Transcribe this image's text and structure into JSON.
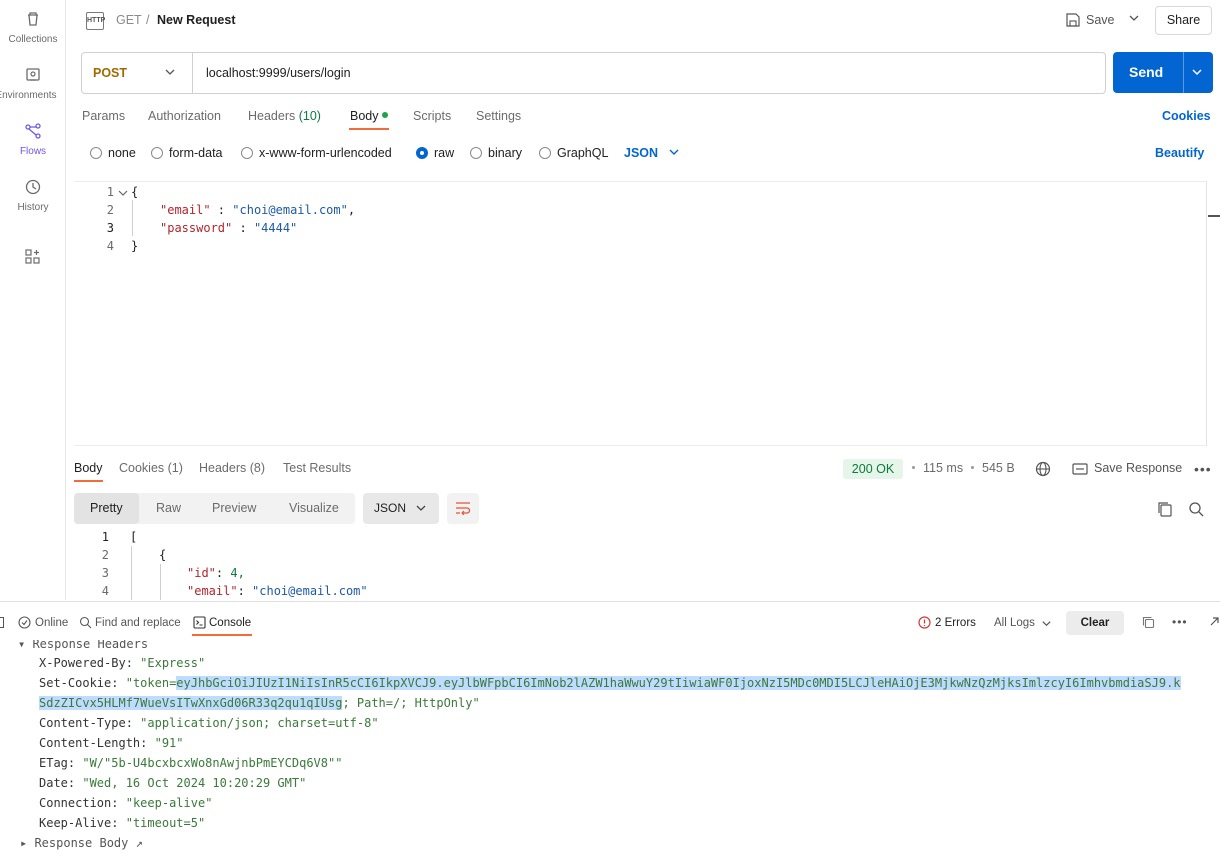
{
  "sidebar": {
    "items": [
      {
        "label": "Collections",
        "icon": "trash-can-icon"
      },
      {
        "label": "Environments",
        "icon": "environment-icon"
      },
      {
        "label": "Flows",
        "icon": "flows-icon"
      },
      {
        "label": "History",
        "icon": "history-icon"
      },
      {
        "label": "",
        "icon": "add-apps-icon"
      }
    ]
  },
  "header": {
    "badge": "HTTP",
    "method_crumb": "GET",
    "separator": "/",
    "title": "New Request",
    "save_label": "Save",
    "share_label": "Share"
  },
  "request": {
    "method": "POST",
    "url": "localhost:9999/users/login",
    "send_label": "Send",
    "tabs": [
      {
        "label": "Params"
      },
      {
        "label": "Authorization"
      },
      {
        "label": "Headers"
      },
      {
        "label": "Body"
      },
      {
        "label": "Scripts"
      },
      {
        "label": "Settings"
      }
    ],
    "headers_count": "(10)",
    "cookies_link": "Cookies",
    "body_types": [
      "none",
      "form-data",
      "x-www-form-urlencoded",
      "raw",
      "binary",
      "GraphQL"
    ],
    "selected_body_type": "raw",
    "format": "JSON",
    "beautify_label": "Beautify",
    "code_lines": [
      "1",
      "2",
      "3",
      "4"
    ],
    "code": {
      "open": "{",
      "email_key": "\"email\"",
      "email_val": "\"choi@email.com\"",
      "password_key": "\"password\"",
      "password_val": "\"4444\"",
      "close": "}"
    }
  },
  "response": {
    "tabs": [
      {
        "label": "Body"
      },
      {
        "label": "Cookies (1)"
      },
      {
        "label": "Headers (8)"
      },
      {
        "label": "Test Results"
      }
    ],
    "status": "200 OK",
    "time": "115 ms",
    "size": "545 B",
    "save_response": "Save Response",
    "view_modes": [
      "Pretty",
      "Raw",
      "Preview",
      "Visualize"
    ],
    "format": "JSON",
    "code_lines": [
      "1",
      "2",
      "3",
      "4"
    ],
    "code": {
      "l1": "[",
      "l2": "{",
      "id_key": "\"id\"",
      "id_val": "4,",
      "email_key": "\"email\"",
      "email_val": "\"choi@email.com\""
    }
  },
  "console": {
    "online": "Online",
    "find_replace": "Find and replace",
    "console_label": "Console",
    "errors": "2 Errors",
    "logs_filter": "All Logs",
    "clear_label": "Clear",
    "section_title": "Response Headers",
    "headers": [
      {
        "key": "X-Powered-By:",
        "value": "\"Express\""
      },
      {
        "key": "Set-Cookie:",
        "value_prefix": "\"token=",
        "value_highlight_1": "eyJhbGciOiJIUzI1NiIsInR5cCI6IkpXVCJ9.eyJlbWFpbCI6ImNob2lAZW1haWwuY29tIiwiaWF0IjoxNzI5MDc0MDI5LCJleHAiOjE3MjkwNzQzMjksImlzcyI6ImhvbmdiaSJ9.k",
        "value_highlight_2": "SdzZICvx5HLMf7WueVsITwXnxGd06R33q2qu1qIUsg",
        "value_suffix": "; Path=/; HttpOnly\""
      },
      {
        "key": "Content-Type:",
        "value": "\"application/json; charset=utf-8\""
      },
      {
        "key": "Content-Length:",
        "value": "\"91\""
      },
      {
        "key": "ETag:",
        "value": "\"W/\"5b-U4bcxbcxWo8nAwjnbPmEYCDq6V8\"\""
      },
      {
        "key": "Date:",
        "value": "\"Wed, 16 Oct 2024 10:20:29 GMT\""
      },
      {
        "key": "Connection:",
        "value": "\"keep-alive\""
      },
      {
        "key": "Keep-Alive:",
        "value": "\"timeout=5\""
      }
    ],
    "response_body": "Response Body ↗"
  },
  "colors": {
    "accent_blue": "#0265d2",
    "flows_purple": "#7156e8",
    "status_green": "#0f7a3c",
    "highlight": "#bfdbff"
  }
}
